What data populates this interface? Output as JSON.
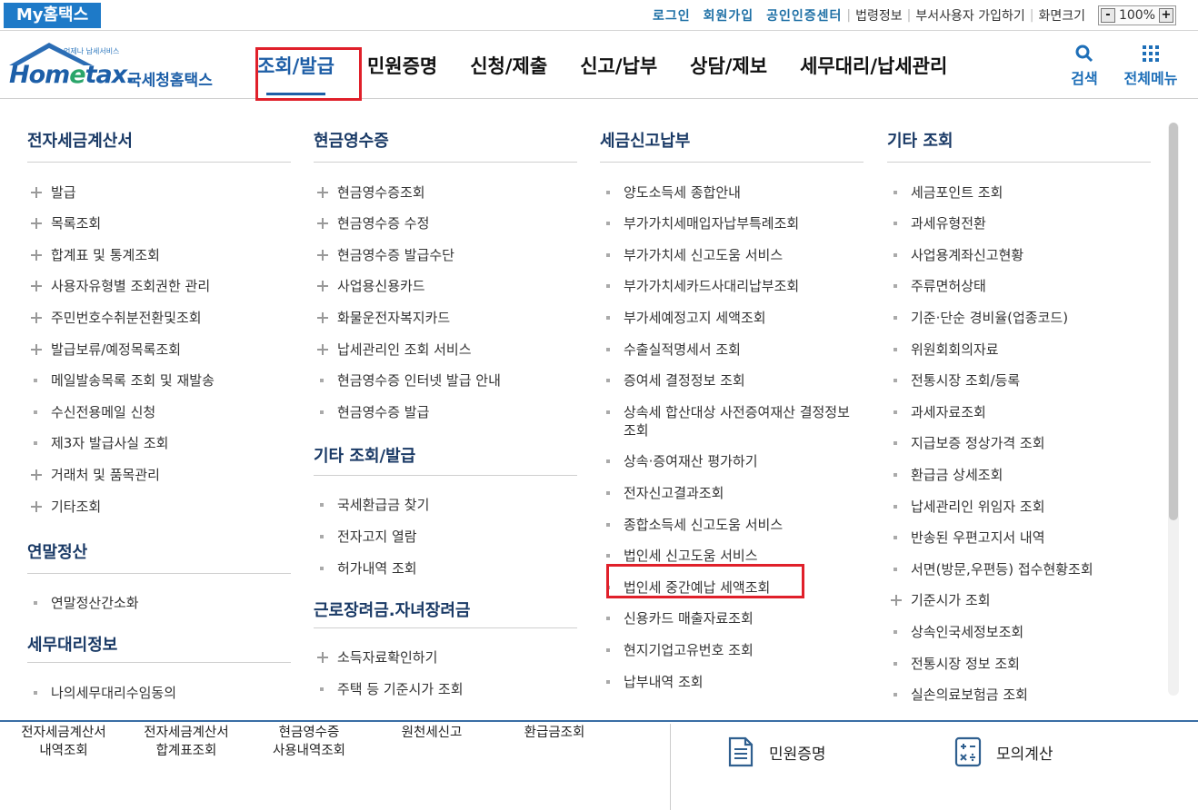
{
  "topbar": {
    "my_hometax": "My홈택스",
    "login": "로그인",
    "signup": "회원가입",
    "cert_center": "공인인증센터",
    "law_info": "법령정보",
    "dept_user_signup": "부서사용자 가입하기",
    "screen_size_label": "화면크기",
    "zoom_minus": "-",
    "zoom_value": "100%",
    "zoom_plus": "+"
  },
  "header": {
    "logo_tagline": "언제나 납세서비스",
    "logo_text_home": "Hom",
    "logo_text_e": "e",
    "logo_text_tax": "tax.",
    "logo_text_korean": "국세청홈택스",
    "nav": [
      "조회/발급",
      "민원증명",
      "신청/제출",
      "신고/납부",
      "상담/제보",
      "세무대리/납세관리"
    ],
    "active_nav": "조회/발급",
    "search_label": "검색",
    "all_menu_label": "전체메뉴"
  },
  "colors": {
    "brand": "#1e5ea6",
    "highlight": "#e0202a",
    "section_title": "#1a3a66"
  },
  "columns": [
    {
      "sections": [
        {
          "title": "전자세금계산서",
          "items": [
            {
              "label": "발급",
              "marker": "plus"
            },
            {
              "label": "목록조회",
              "marker": "plus"
            },
            {
              "label": "합계표 및 통계조회",
              "marker": "plus"
            },
            {
              "label": "사용자유형별 조회권한 관리",
              "marker": "plus"
            },
            {
              "label": "주민번호수취분전환및조회",
              "marker": "plus"
            },
            {
              "label": "발급보류/예정목록조회",
              "marker": "plus"
            },
            {
              "label": "메일발송목록 조회 및 재발송",
              "marker": "dot"
            },
            {
              "label": "수신전용메일 신청",
              "marker": "dot"
            },
            {
              "label": "제3자 발급사실 조회",
              "marker": "dot"
            },
            {
              "label": "거래처 및 품목관리",
              "marker": "plus"
            },
            {
              "label": "기타조회",
              "marker": "plus"
            }
          ]
        },
        {
          "title": "연말정산",
          "items": [
            {
              "label": "연말정산간소화",
              "marker": "dot"
            }
          ]
        },
        {
          "title": "세무대리정보",
          "items": [
            {
              "label": "나의세무대리수임동의",
              "marker": "dot"
            }
          ]
        }
      ]
    },
    {
      "sections": [
        {
          "title": "현금영수증",
          "items": [
            {
              "label": "현금영수증조회",
              "marker": "plus"
            },
            {
              "label": "현금영수증 수정",
              "marker": "plus"
            },
            {
              "label": "현금영수증 발급수단",
              "marker": "plus"
            },
            {
              "label": "사업용신용카드",
              "marker": "plus"
            },
            {
              "label": "화물운전자복지카드",
              "marker": "plus"
            },
            {
              "label": "납세관리인 조회 서비스",
              "marker": "plus"
            },
            {
              "label": "현금영수증 인터넷 발급 안내",
              "marker": "dot"
            },
            {
              "label": "현금영수증 발급",
              "marker": "dot"
            }
          ]
        },
        {
          "title": "기타 조회/발급",
          "items": [
            {
              "label": "국세환급금 찾기",
              "marker": "dot"
            },
            {
              "label": "전자고지 열람",
              "marker": "dot"
            },
            {
              "label": "허가내역 조회",
              "marker": "dot"
            }
          ]
        },
        {
          "title": "근로장려금.자녀장려금",
          "items": [
            {
              "label": "소득자료확인하기",
              "marker": "plus"
            },
            {
              "label": "주택 등 기준시가 조회",
              "marker": "dot"
            }
          ]
        }
      ]
    },
    {
      "sections": [
        {
          "title": "세금신고납부",
          "items": [
            {
              "label": "양도소득세 종합안내",
              "marker": "dot"
            },
            {
              "label": "부가가치세매입자납부특례조회",
              "marker": "dot"
            },
            {
              "label": "부가가치세 신고도움 서비스",
              "marker": "dot"
            },
            {
              "label": "부가가치세카드사대리납부조회",
              "marker": "dot"
            },
            {
              "label": "부가세예정고지 세액조회",
              "marker": "dot"
            },
            {
              "label": "수출실적명세서 조회",
              "marker": "dot"
            },
            {
              "label": "증여세 결정정보 조회",
              "marker": "dot"
            },
            {
              "label": "상속세 합산대상 사전증여재산 결정정보 조회",
              "marker": "dot"
            },
            {
              "label": "상속·증여재산 평가하기",
              "marker": "dot"
            },
            {
              "label": "전자신고결과조회",
              "marker": "dot"
            },
            {
              "label": "종합소득세 신고도움 서비스",
              "marker": "dot"
            },
            {
              "label": "법인세 신고도움 서비스",
              "marker": "dot"
            },
            {
              "label": "법인세 중간예납 세액조회",
              "marker": "dot",
              "highlight": true
            },
            {
              "label": "신용카드 매출자료조회",
              "marker": "dot"
            },
            {
              "label": "현지기업고유번호 조회",
              "marker": "dot"
            },
            {
              "label": "납부내역 조회",
              "marker": "dot"
            }
          ]
        }
      ]
    },
    {
      "sections": [
        {
          "title": "기타 조회",
          "items": [
            {
              "label": "세금포인트 조회",
              "marker": "dot"
            },
            {
              "label": "과세유형전환",
              "marker": "dot"
            },
            {
              "label": "사업용계좌신고현황",
              "marker": "dot"
            },
            {
              "label": "주류면허상태",
              "marker": "dot"
            },
            {
              "label": "기준·단순 경비율(업종코드)",
              "marker": "dot"
            },
            {
              "label": "위원회회의자료",
              "marker": "dot"
            },
            {
              "label": "전통시장 조회/등록",
              "marker": "dot"
            },
            {
              "label": "과세자료조회",
              "marker": "dot"
            },
            {
              "label": "지급보증 정상가격 조회",
              "marker": "dot"
            },
            {
              "label": "환급금 상세조회",
              "marker": "dot"
            },
            {
              "label": "납세관리인 위임자 조회",
              "marker": "dot"
            },
            {
              "label": "반송된 우편고지서 내역",
              "marker": "dot"
            },
            {
              "label": "서면(방문,우편등) 접수현황조회",
              "marker": "dot"
            },
            {
              "label": "기준시가 조회",
              "marker": "plus"
            },
            {
              "label": "상속인국세정보조회",
              "marker": "dot"
            },
            {
              "label": "전통시장 정보 조회",
              "marker": "dot"
            },
            {
              "label": "실손의료보험금 조회",
              "marker": "dot"
            }
          ]
        }
      ]
    }
  ],
  "bottom": {
    "quick_links": [
      [
        "전자세금계산서",
        "내역조회"
      ],
      [
        "전자세금계산서",
        "합계표조회"
      ],
      [
        "현금영수증",
        "사용내역조회"
      ],
      [
        "원천세신고"
      ],
      [
        "환급금조회"
      ]
    ],
    "civil_cert": "민원증명",
    "mock_calc": "모의계산"
  }
}
